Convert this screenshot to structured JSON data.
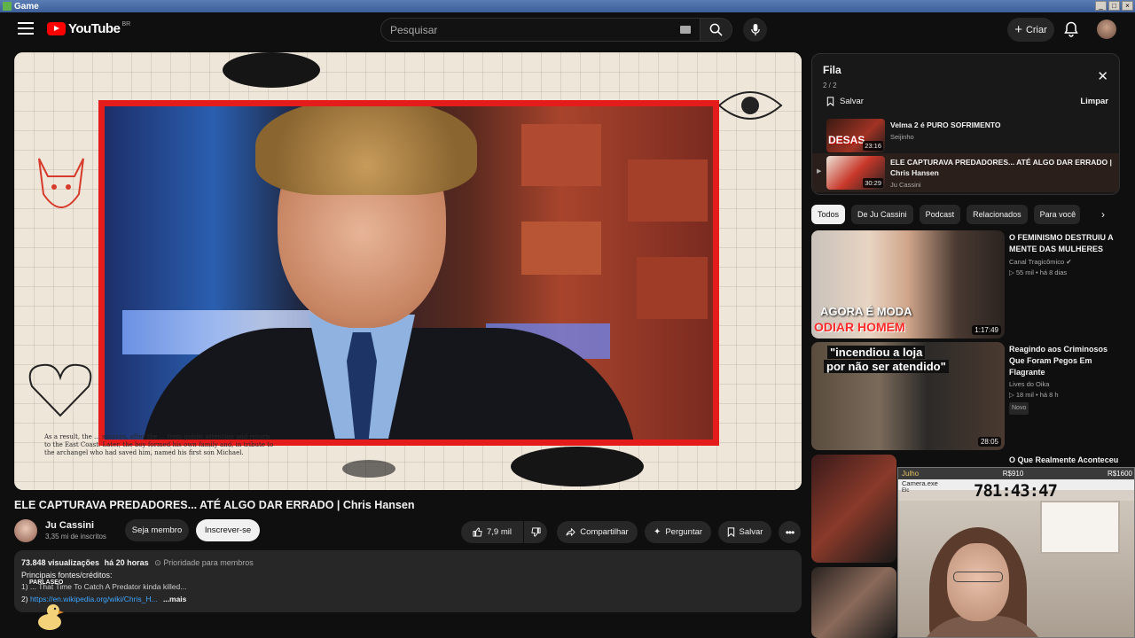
{
  "window": {
    "title": "Game",
    "buttons": [
      "_",
      "□",
      "×"
    ]
  },
  "header": {
    "logo_text": "YouTube",
    "logo_country": "BR",
    "search_placeholder": "Pesquisar",
    "create_label": "Criar"
  },
  "video": {
    "title": "ELE CAPTURAVA PREDADORES... ATÉ ALGO DAR ERRADO | Chris Hansen",
    "frame_caption": "As a result, the ... sources, after the ... from public attention and return to the East Coast. Later, the boy formed his own family and, in tribute to the archangel who had saved him, named his first son Michael."
  },
  "channel": {
    "name": "Ju Cassini",
    "subscribers": "3,35 mi de inscritos",
    "member_label": "Seja membro",
    "subscribe_label": "Inscrever-se"
  },
  "actions": {
    "likes": "7,9 mil",
    "share": "Compartilhar",
    "ask": "Perguntar",
    "save": "Salvar"
  },
  "description": {
    "views": "73.848 visualizações",
    "age": "há 20 horas",
    "priority": "Prioridade para membros",
    "sources_label": "Principais fontes/créditos:",
    "item1_num": "1)",
    "item1": "... That Time To Catch A Predator kinda killed...",
    "item2_num": "2)",
    "item2_link": "https://en.wikipedia.org/wiki/Chris_H...",
    "more": "...mais",
    "overlay_tag": "PARLASEO"
  },
  "queue": {
    "title": "Fila",
    "count": "2 / 2",
    "save_label": "Salvar",
    "clear_label": "Limpar",
    "items": [
      {
        "title": "Velma 2 é PURO SOFRIMENTO",
        "channel": "Seijinho",
        "duration": "23:16",
        "thumb_text": "DESAS"
      },
      {
        "title": "ELE CAPTURAVA PREDADORES... ATÉ ALGO DAR ERRADO | Chris Hansen",
        "channel": "Ju Cassini",
        "duration": "30:29"
      }
    ]
  },
  "chips": [
    "Todos",
    "De Ju Cassini",
    "Podcast",
    "Relacionados",
    "Para você"
  ],
  "recommendations": [
    {
      "title": "O FEMINISMO DESTRUIU A MENTE DAS MULHERES",
      "channel": "Canal Tragicômico",
      "views": "55 mil",
      "age": "há 8 dias",
      "duration": "1:17:49",
      "thumb_line1": "AGORA É MODA",
      "thumb_line2": "ODIAR HOMEM"
    },
    {
      "title": "Reagindo aos Criminosos Que Foram Pegos Em Flagrante",
      "channel": "Lives do Oika",
      "views": "18 mil",
      "age": "há 8 h",
      "badge": "Novo",
      "duration": "28:05",
      "thumb_line1": "\"incendiou a loja",
      "thumb_line2": "por não ser atendido\""
    },
    {
      "title": "O Que Realmente Aconteceu"
    }
  ],
  "webcam": {
    "header_left": "Julho",
    "header_mid": "R$910",
    "header_right": "R$1600",
    "sub_label": "Camera.exe",
    "sub_label2": "Elc",
    "timer": "781:43:47"
  },
  "colors": {
    "accent": "#ff0000",
    "frame_red": "#e41c1c",
    "link": "#3ea6ff"
  }
}
